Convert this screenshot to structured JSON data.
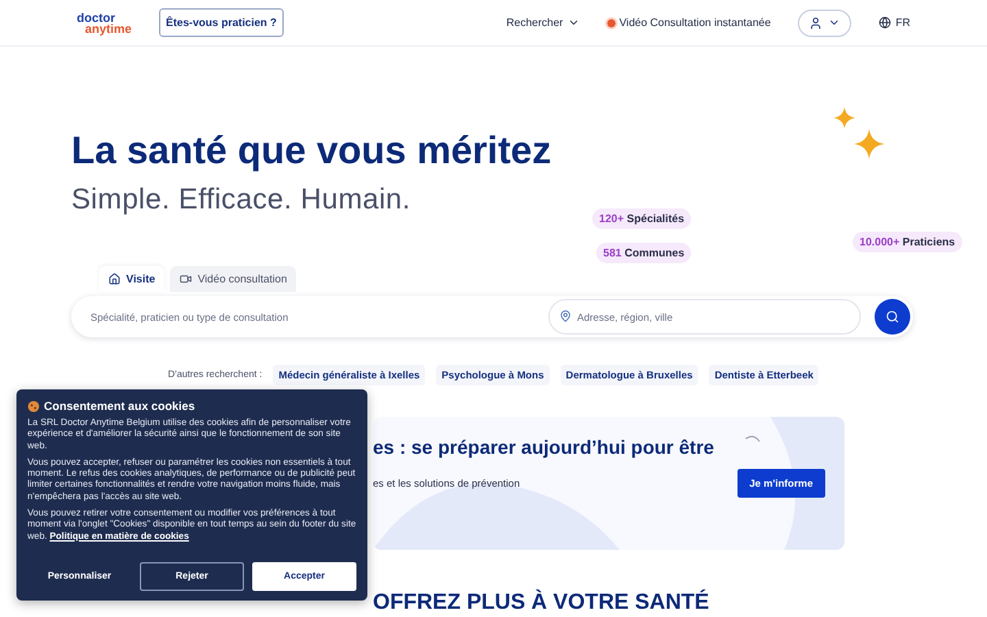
{
  "header": {
    "logo_top": "doctor",
    "logo_bottom": "anytime",
    "practitioner_button": "Êtes-vous praticien ?",
    "search_menu": "Rechercher",
    "video_link": "Vidéo Consultation instantanée",
    "language": "FR"
  },
  "hero": {
    "title": "La santé que vous méritez",
    "subtitle": "Simple. Efficace. Humain.",
    "stats": [
      {
        "number": "120+",
        "label": "Spécialités"
      },
      {
        "number": "581",
        "label": "Communes"
      },
      {
        "number": "10.000+",
        "label": "Praticiens"
      }
    ]
  },
  "search": {
    "tabs": [
      {
        "label": "Visite",
        "selected": true,
        "kind": "home"
      },
      {
        "label": "Vidéo consultation",
        "selected": false,
        "kind": "video"
      }
    ],
    "query_placeholder": "Spécialité, praticien ou type de consultation",
    "location_placeholder": "Adresse, région, ville"
  },
  "suggestions": {
    "label": "D'autres recherchent :",
    "items": [
      "Médecin généraliste à Ixelles",
      "Psychologue à Mons",
      "Dermatologue à Bruxelles",
      "Dentiste à Etterbeek"
    ]
  },
  "promo": {
    "title": "es : se préparer aujourd’hui pour être",
    "text": "es et les solutions de prévention",
    "button": "Je m'informe"
  },
  "section_heading": "OFFREZ PLUS À VOTRE SANTÉ",
  "cookie_banner": {
    "title": "Consentement aux cookies",
    "paragraphs": [
      "La SRL Doctor Anytime Belgium utilise des cookies afin de personnaliser votre expérience et d'améliorer la sécurité ainsi que le fonctionnement de son site web.",
      "Vous pouvez accepter, refuser ou paramétrer les cookies non essentiels à tout moment. Le refus des cookies analytiques, de performance ou de publicité peut limiter certaines fonctionnalités et rendre votre navigation moins fluide, mais n'empêchera pas l'accès au site web.",
      "Vous pouvez retirer votre consentement ou modifier vos préférences à tout moment via l'onglet \"Cookies\" disponible en tout temps au sein du footer du site web."
    ],
    "policy_link": "Politique en matière de cookies",
    "buttons": [
      {
        "label": "Personnaliser",
        "kind": "plain"
      },
      {
        "label": "Rejeter",
        "kind": "outline"
      },
      {
        "label": "Accepter",
        "kind": "filled"
      }
    ]
  }
}
